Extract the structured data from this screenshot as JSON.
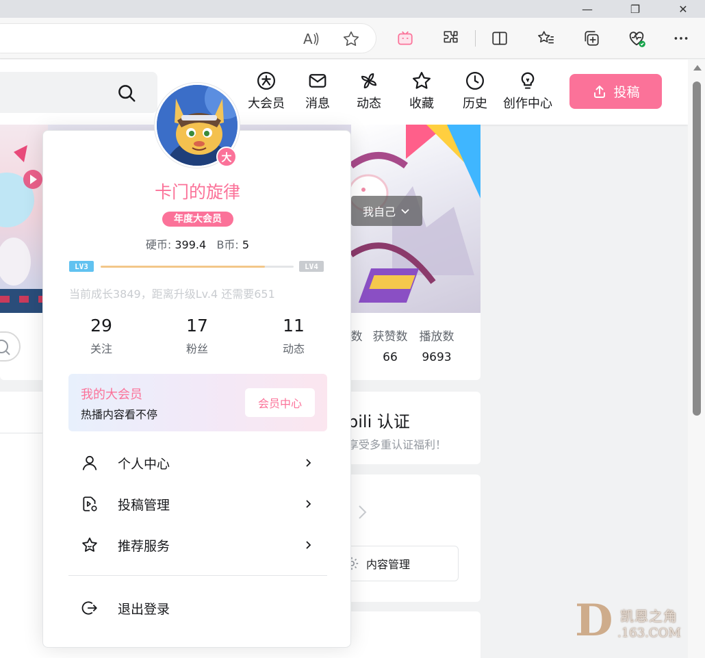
{
  "browser": {
    "window_controls": {
      "minimize": "—",
      "restore": "❐",
      "close": "✕"
    },
    "toolbar_icons": [
      "read-aloud-icon",
      "favorite-star-icon",
      "bilibili-tv-icon",
      "extensions-puzzle-icon",
      "split-screen-icon",
      "favorites-list-icon",
      "collections-icon",
      "browser-essentials-icon",
      "more-menu-icon"
    ]
  },
  "header": {
    "nav": [
      {
        "label": "大会员",
        "icon": "vip-icon"
      },
      {
        "label": "消息",
        "icon": "mail-icon"
      },
      {
        "label": "动态",
        "icon": "pinwheel-icon"
      },
      {
        "label": "收藏",
        "icon": "star-icon"
      },
      {
        "label": "历史",
        "icon": "clock-icon"
      },
      {
        "label": "创作中心",
        "icon": "lightbulb-icon"
      }
    ],
    "upload_label": "投稿"
  },
  "banner": {
    "self_button": "我自己"
  },
  "stats": {
    "cols": [
      {
        "label": "数",
        "value": ""
      },
      {
        "label": "获赞数",
        "value": "66"
      },
      {
        "label": "播放数",
        "value": "9693"
      }
    ]
  },
  "verify": {
    "title": "bili 认证",
    "subtitle": "享受多重认证福利！"
  },
  "content_mgmt_label": "内容管理",
  "profile": {
    "avatar_badge": "大",
    "username": "卡门的旋律",
    "vip_tag": "年度大会员",
    "coins_label": "硬币:",
    "coins_value": "399.4",
    "bcoins_label": "B币:",
    "bcoins_value": "5",
    "level_current": "LV3",
    "level_next": "LV4",
    "level_progress": 0.85,
    "growth_text": "当前成长3849，距离升级Lv.4 还需要651",
    "counts": [
      {
        "num": "29",
        "label": "关注"
      },
      {
        "num": "17",
        "label": "粉丝"
      },
      {
        "num": "11",
        "label": "动态"
      }
    ],
    "vip_card": {
      "title": "我的大会员",
      "subtitle": "热播内容看不停",
      "button": "会员中心"
    },
    "menu": [
      {
        "label": "个人中心",
        "icon": "user-icon"
      },
      {
        "label": "投稿管理",
        "icon": "upload-manage-icon"
      },
      {
        "label": "推荐服务",
        "icon": "star-outline-icon"
      }
    ],
    "logout": "退出登录"
  },
  "watermark": {
    "logo_letter": "D",
    "line1": "凯恩之角",
    "line2": ".163.COM"
  },
  "colors": {
    "accent": "#fb7299",
    "level_badge": "#61c2f0",
    "progress": "#f2c789"
  }
}
